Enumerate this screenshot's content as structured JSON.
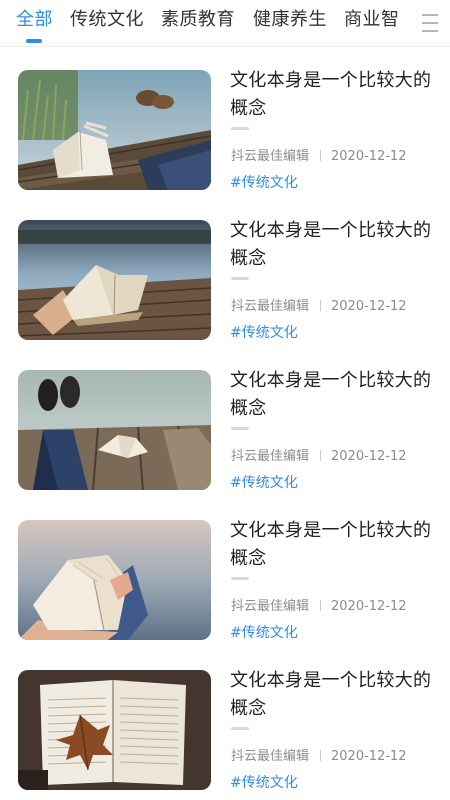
{
  "tabs": [
    {
      "label": "全部",
      "active": true
    },
    {
      "label": "传统文化",
      "active": false
    },
    {
      "label": "素质教育",
      "active": false
    },
    {
      "label": "健康养生",
      "active": false
    },
    {
      "label": "商业智",
      "active": false
    }
  ],
  "menu_icon": "hamburger-menu-icon",
  "accent_color": "#2f8ce9",
  "articles": [
    {
      "title": "文化本身是一个比较大的概念",
      "author": "抖云最佳编辑",
      "date": "2020-12-12",
      "tag": "#传统文化",
      "image": "open-book-on-dock-with-feet"
    },
    {
      "title": "文化本身是一个比较大的概念",
      "author": "抖云最佳编辑",
      "date": "2020-12-12",
      "tag": "#传统文化",
      "image": "open-book-on-pier-by-lake"
    },
    {
      "title": "文化本身是一个比较大的概念",
      "author": "抖云最佳编辑",
      "date": "2020-12-12",
      "tag": "#传统文化",
      "image": "feet-and-book-on-wooden-pier"
    },
    {
      "title": "文化本身是一个比较大的概念",
      "author": "抖云最佳编辑",
      "date": "2020-12-12",
      "tag": "#传统文化",
      "image": "hands-holding-open-book"
    },
    {
      "title": "文化本身是一个比较大的概念",
      "author": "抖云最佳编辑",
      "date": "2020-12-12",
      "tag": "#传统文化",
      "image": "open-book-with-autumn-leaf"
    }
  ]
}
